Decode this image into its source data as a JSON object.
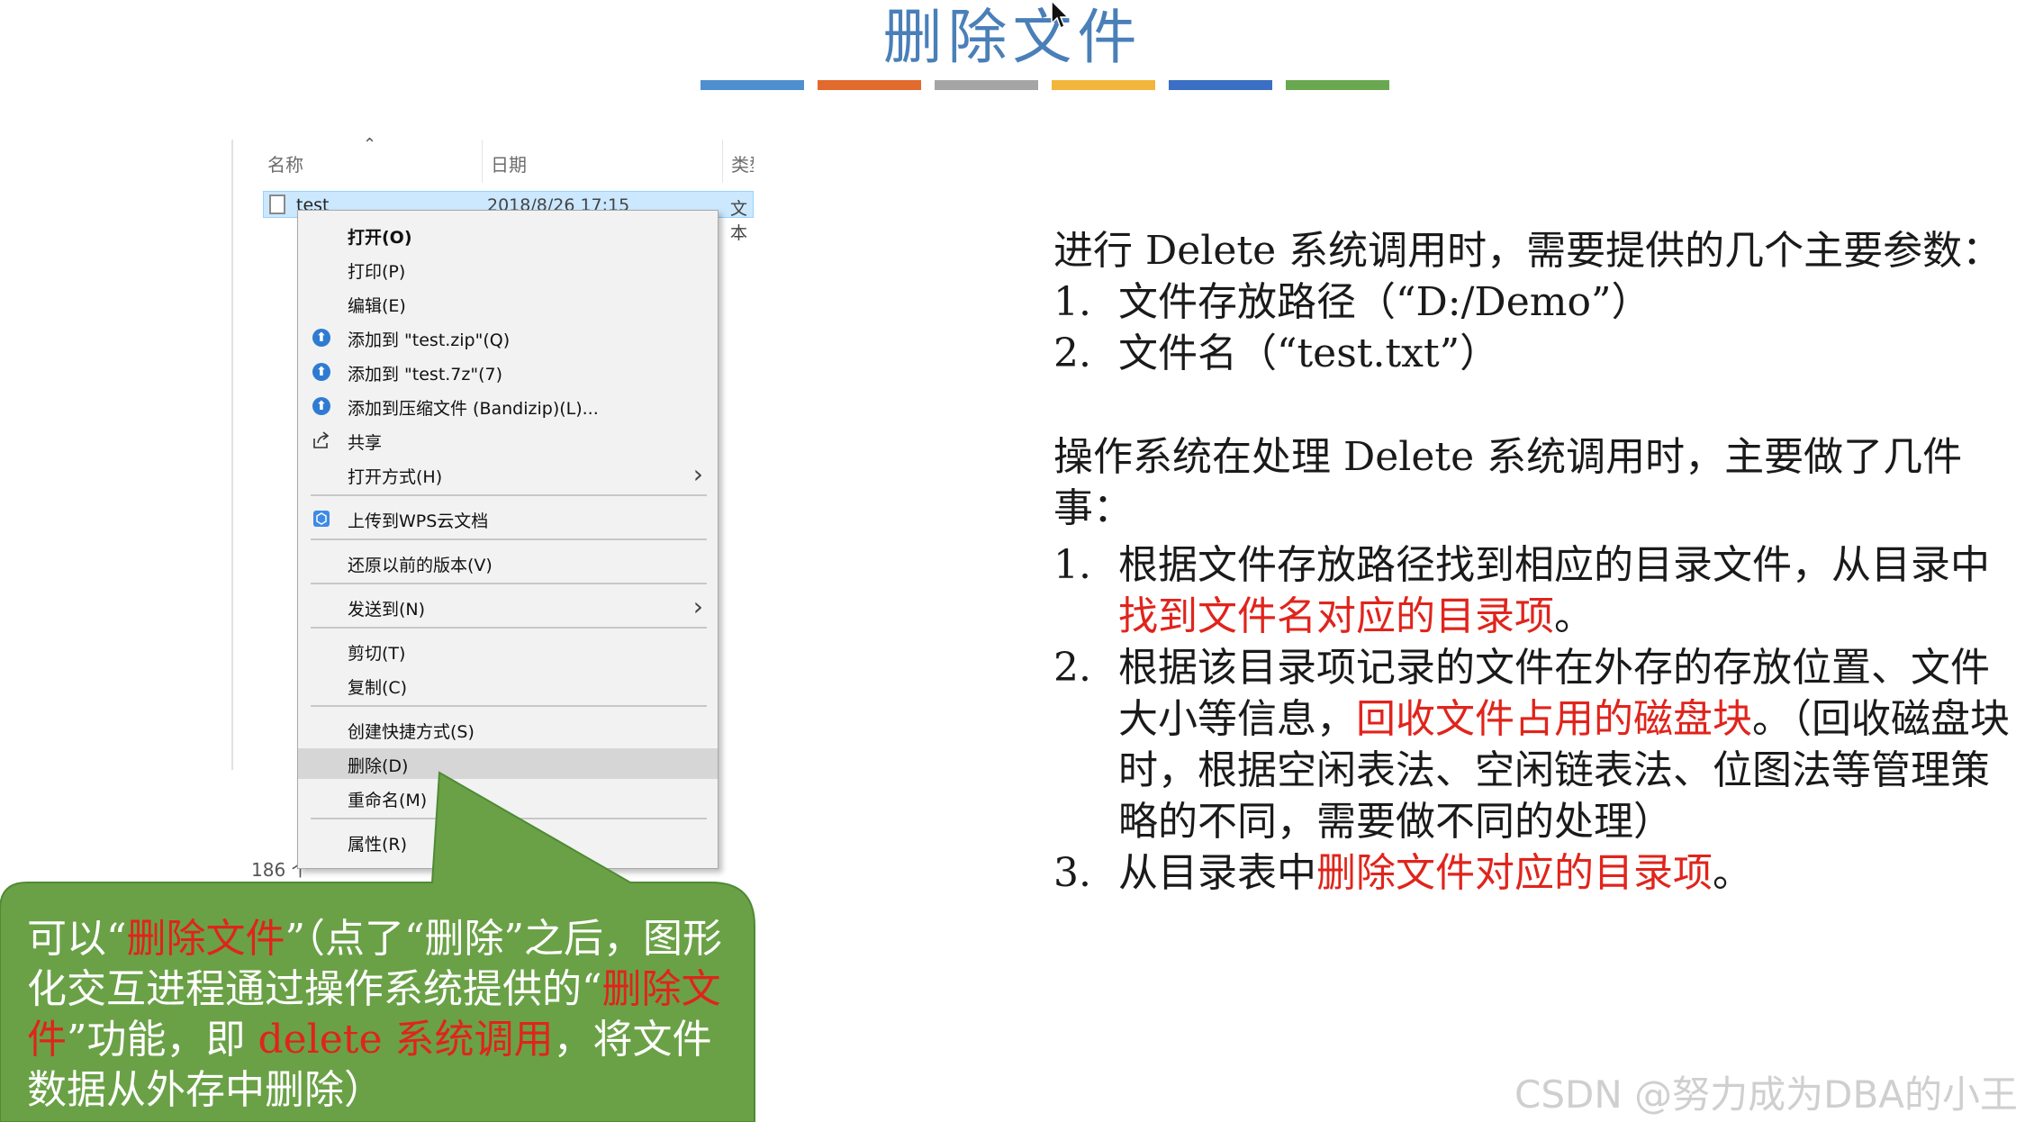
{
  "slide": {
    "title": "删除文件",
    "stripe_colors": [
      "#4f8fcf",
      "#e26a2c",
      "#a5a5a5",
      "#f2b63c",
      "#3a6fc4",
      "#6aa84f"
    ]
  },
  "explorer": {
    "columns": [
      "名称",
      "日期",
      "类型"
    ],
    "file": {
      "name": "test",
      "date": "2018/8/26 17:15",
      "type": "文本"
    },
    "status": "186 个"
  },
  "context_menu": {
    "items": [
      {
        "label": "打开(O)"
      },
      {
        "label": "打印(P)"
      },
      {
        "label": "编辑(E)"
      },
      {
        "label": "添加到 \"test.zip\"(Q)"
      },
      {
        "label": "添加到 \"test.7z\"(7)"
      },
      {
        "label": "添加到压缩文件 (Bandizip)(L)..."
      },
      {
        "label": "共享"
      },
      {
        "label": "打开方式(H)"
      },
      {
        "label": "上传到WPS云文档"
      },
      {
        "label": "还原以前的版本(V)"
      },
      {
        "label": "发送到(N)"
      },
      {
        "label": "剪切(T)"
      },
      {
        "label": "复制(C)"
      },
      {
        "label": "创建快捷方式(S)"
      },
      {
        "label": "删除(D)"
      },
      {
        "label": "重命名(M)"
      },
      {
        "label": "属性(R)"
      }
    ]
  },
  "callout": {
    "t1": "可以“",
    "t2": "删除文件",
    "t3": "”（点了“删除”之后，图形化交互进程通过操作系统提供的“",
    "t4": "删除文件",
    "t5": "”功能，即 ",
    "t6": "delete 系统调用",
    "t7": "，将文件数据从外存中删除）",
    "bg_color": "#6aa146"
  },
  "params": {
    "intro": "进行 Delete 系统调用时，需要提供的几个主要参数：",
    "items": [
      {
        "num": "1.",
        "text": "文件存放路径（“D:/Demo”）"
      },
      {
        "num": "2.",
        "text": "文件名（“test.txt”）"
      }
    ]
  },
  "process": {
    "intro": "操作系统在处理 Delete 系统调用时，主要做了几件事：",
    "s1": {
      "num": "1.",
      "a": "根据文件存放路径找到相应的目录文件，从目录中",
      "b": "找到文件名对应的目录项",
      "c": "。"
    },
    "s2": {
      "num": "2.",
      "a": "根据该目录项记录的文件在外存的存放位置、文件大小等信息，",
      "b": "回收文件占用的磁盘块",
      "c": "。（回收磁盘块时，根据空闲表法、空闲链表法、位图法等管理策略的不同，需要做不同的处理）"
    },
    "s3": {
      "num": "3.",
      "a": "从目录表中",
      "b": "删除文件对应的目录项",
      "c": "。"
    }
  },
  "watermark": "CSDN @努力成为DBA的小王"
}
